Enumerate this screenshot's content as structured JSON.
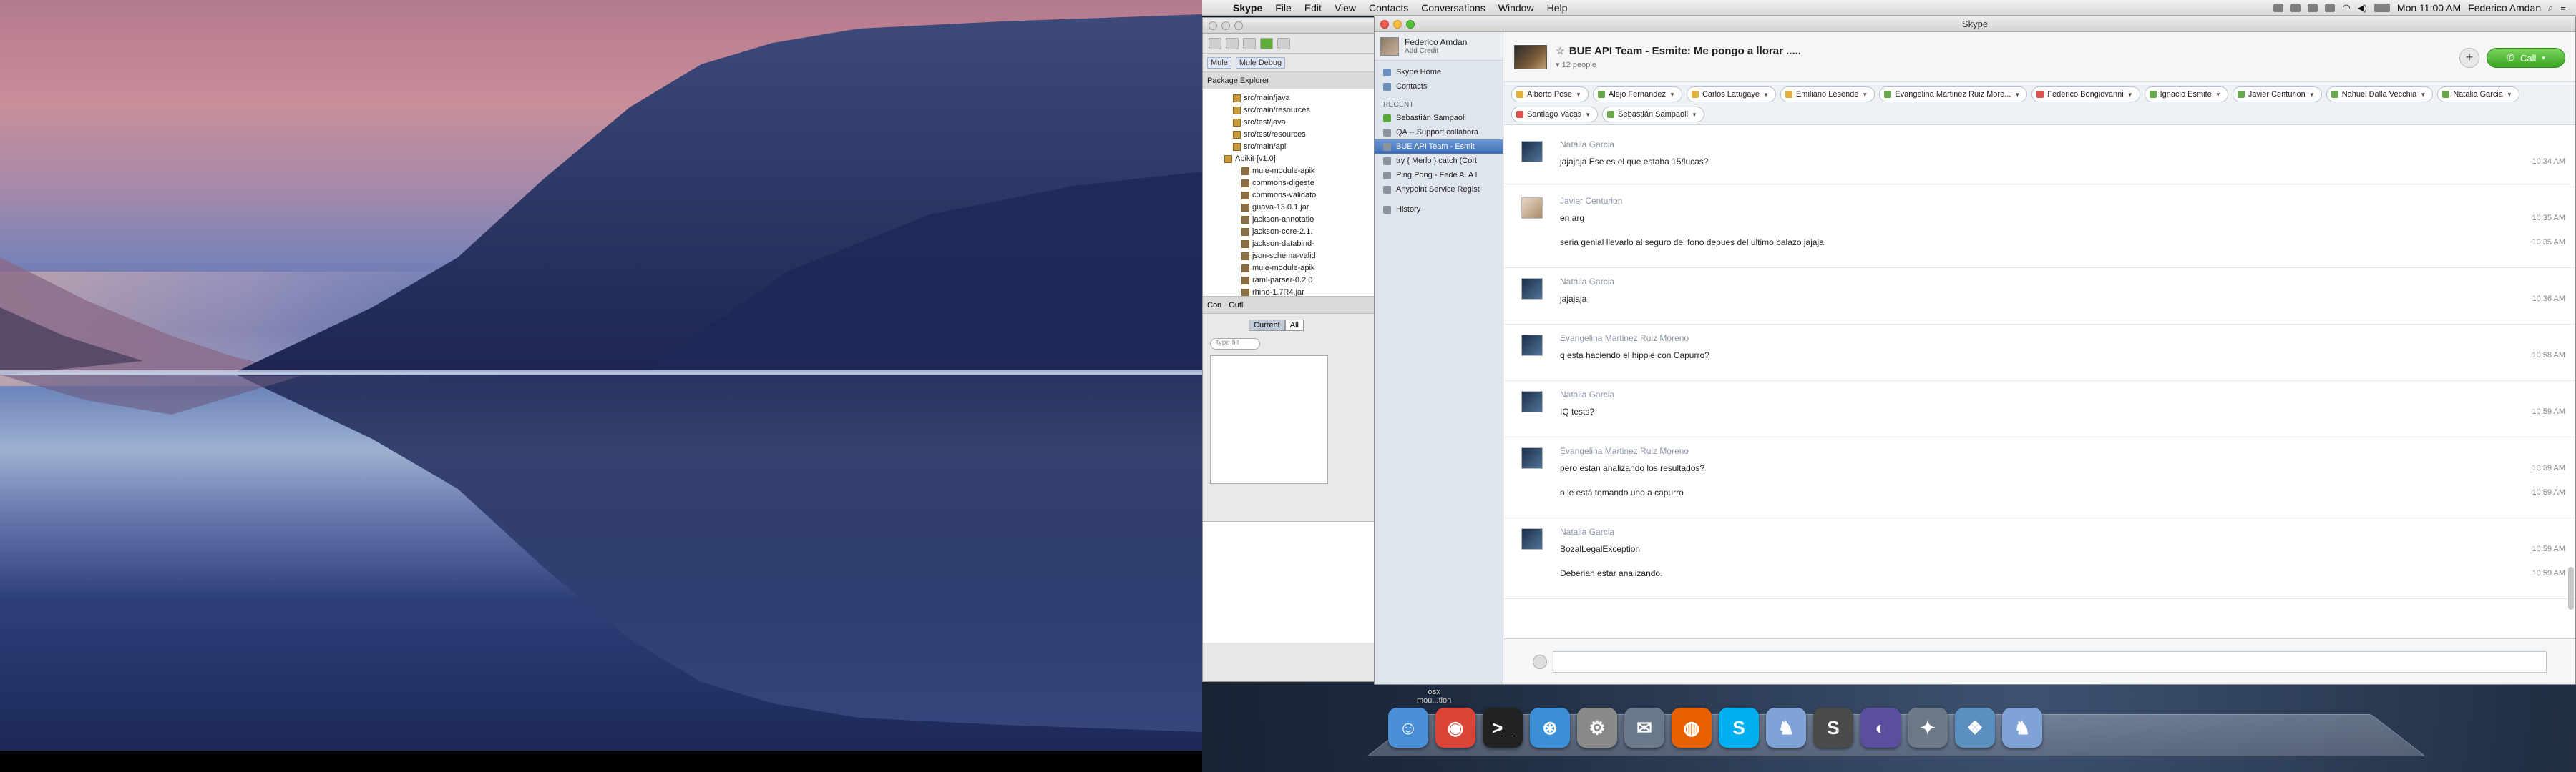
{
  "menubar": {
    "app": "Skype",
    "menus": [
      "File",
      "Edit",
      "View",
      "Contacts",
      "Conversations",
      "Window",
      "Help"
    ],
    "clock": "Mon 11:00 AM",
    "user": "Federico Amdan",
    "search_placeholder": "Search"
  },
  "eclipse": {
    "perspectives": [
      "Mule",
      "Mule Debug"
    ],
    "package_explorer_tab": "Package Explorer",
    "tree": [
      {
        "label": "src/main/java",
        "kind": "folder",
        "indent": 1
      },
      {
        "label": "src/main/resources",
        "kind": "folder",
        "indent": 1
      },
      {
        "label": "src/test/java",
        "kind": "folder",
        "indent": 1
      },
      {
        "label": "src/test/resources",
        "kind": "folder",
        "indent": 1
      },
      {
        "label": "src/main/api",
        "kind": "folder",
        "indent": 1
      },
      {
        "label": "Apikit [v1.0]",
        "kind": "folder",
        "indent": 0
      },
      {
        "label": "mule-module-apik",
        "kind": "jar",
        "indent": 2
      },
      {
        "label": "commons-digeste",
        "kind": "jar",
        "indent": 2
      },
      {
        "label": "commons-validato",
        "kind": "jar",
        "indent": 2
      },
      {
        "label": "guava-13.0.1.jar",
        "kind": "jar",
        "indent": 2
      },
      {
        "label": "jackson-annotatio",
        "kind": "jar",
        "indent": 2
      },
      {
        "label": "jackson-core-2.1.",
        "kind": "jar",
        "indent": 2
      },
      {
        "label": "jackson-databind-",
        "kind": "jar",
        "indent": 2
      },
      {
        "label": "json-schema-valid",
        "kind": "jar",
        "indent": 2
      },
      {
        "label": "mule-module-apik",
        "kind": "jar",
        "indent": 2
      },
      {
        "label": "raml-parser-0.2.0",
        "kind": "jar",
        "indent": 2
      },
      {
        "label": "rhino-1.7R4.jar",
        "kind": "jar",
        "indent": 2
      },
      {
        "label": "bin",
        "kind": "folder",
        "indent": 0
      },
      {
        "label": "flows",
        "kind": "folder",
        "indent": 0
      }
    ],
    "console_tabs": [
      "Con",
      "Outl"
    ],
    "filter_segments": [
      "Current",
      "All"
    ],
    "filter_placeholder": "type filt"
  },
  "skype": {
    "window_title": "Skype",
    "profile": {
      "name": "Federico Amdan",
      "status": "Add Credit"
    },
    "nav": [
      {
        "label": "Skype Home",
        "icon": "skype-home-icon"
      },
      {
        "label": "Contacts",
        "icon": "contacts-icon"
      }
    ],
    "recent_label": "RECENT",
    "recent": [
      {
        "label": "Sebastián Sampaoli",
        "status": "green",
        "active": false
      },
      {
        "label": "QA -- Support collabora",
        "status": "grey",
        "active": false
      },
      {
        "label": "BUE API Team - Esmit",
        "status": "grey",
        "active": true
      },
      {
        "label": "try { Merlo } catch (Cort",
        "status": "grey",
        "active": false
      },
      {
        "label": "Ping Pong - Fede A. A l",
        "status": "grey",
        "active": false
      },
      {
        "label": "Anypoint Service Regist",
        "status": "grey",
        "active": false
      }
    ],
    "history_label": "History",
    "conversation": {
      "title": "BUE API Team - Esmite: Me pongo a llorar .....",
      "people": "12 people",
      "call_label": "Call",
      "participants": [
        {
          "name": "Alberto Pose",
          "status": "away"
        },
        {
          "name": "Alejo Fernandez",
          "status": "online"
        },
        {
          "name": "Carlos Latugaye",
          "status": "away"
        },
        {
          "name": "Emiliano Lesende",
          "status": "away"
        },
        {
          "name": "Evangelina Martinez Ruiz More...",
          "status": "online"
        },
        {
          "name": "Federico Bongiovanni",
          "status": "busy"
        },
        {
          "name": "Ignacio Esmite",
          "status": "online"
        },
        {
          "name": "Javier Centurion",
          "status": "online"
        },
        {
          "name": "Nahuel Dalla Vecchia",
          "status": "online"
        },
        {
          "name": "Natalia Garcia",
          "status": "online"
        },
        {
          "name": "Santiago Vacas",
          "status": "busy"
        },
        {
          "name": "Sebastián Sampaoli",
          "status": "online"
        }
      ],
      "messages": [
        {
          "author": "Natalia Garcia",
          "lines": [
            {
              "text": "jajajaja Ese es el que estaba 15/lucas?",
              "time": "10:34 AM"
            }
          ]
        },
        {
          "author": "Javier Centurion",
          "lines": [
            {
              "text": "en arg",
              "time": "10:35 AM"
            },
            {
              "text": "seria genial llevarlo al seguro del fono depues del ultimo balazo jajaja",
              "time": "10:35 AM"
            }
          ]
        },
        {
          "author": "Natalia Garcia",
          "lines": [
            {
              "text": "jajajaja",
              "time": "10:36 AM"
            }
          ]
        },
        {
          "author": "Evangelina Martinez Ruiz Moreno",
          "lines": [
            {
              "text": "q esta haciendo el hippie con Capurro?",
              "time": "10:58 AM"
            }
          ]
        },
        {
          "author": "Natalia Garcia",
          "lines": [
            {
              "text": "IQ tests?",
              "time": "10:59 AM"
            }
          ]
        },
        {
          "author": "Evangelina Martinez Ruiz Moreno",
          "lines": [
            {
              "text": "pero estan analizando los resultados?",
              "time": "10:59 AM"
            },
            {
              "text": "o le está tomando uno a capurro",
              "time": "10:59 AM"
            }
          ]
        },
        {
          "author": "Natalia Garcia",
          "lines": [
            {
              "text": "BozalLegalException",
              "time": "10:59 AM"
            },
            {
              "text": "Deberian estar analizando.",
              "time": "10:59 AM"
            }
          ]
        }
      ]
    }
  },
  "dock": {
    "label": "osx\nmou...tion",
    "apps": [
      {
        "name": "Finder",
        "color": "#4a90d9",
        "glyph": "☺"
      },
      {
        "name": "Chrome",
        "color": "#db4437",
        "glyph": "◉"
      },
      {
        "name": "Terminal",
        "color": "#222222",
        "glyph": ">_"
      },
      {
        "name": "Safari",
        "color": "#3a8fd6",
        "glyph": "⊛"
      },
      {
        "name": "System Preferences",
        "color": "#8a8a8a",
        "glyph": "⚙"
      },
      {
        "name": "Mail",
        "color": "#6a7a8a",
        "glyph": "✉"
      },
      {
        "name": "Firefox",
        "color": "#e66000",
        "glyph": "◍"
      },
      {
        "name": "Skype",
        "color": "#00aff0",
        "glyph": "S"
      },
      {
        "name": "Rabbit",
        "color": "#7fa3d6",
        "glyph": "♞"
      },
      {
        "name": "Sublime Text",
        "color": "#4b4b4b",
        "glyph": "S"
      },
      {
        "name": "Eclipse",
        "color": "#5b4e9e",
        "glyph": "◐"
      },
      {
        "name": "Mule",
        "color": "#6c7a88",
        "glyph": "✦"
      },
      {
        "name": "Preview",
        "color": "#5a8fc0",
        "glyph": "❖"
      },
      {
        "name": "Rabbit 2",
        "color": "#7fa3d6",
        "glyph": "♞"
      }
    ]
  }
}
